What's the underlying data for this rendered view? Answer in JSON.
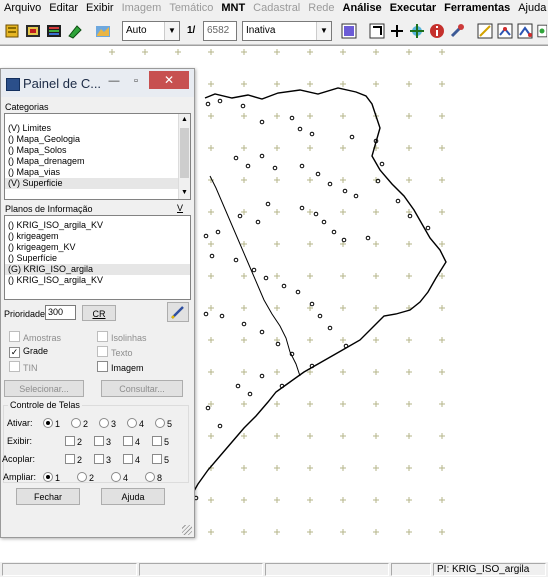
{
  "menu": [
    {
      "label": "Arquivo",
      "disabled": false,
      "bold": false
    },
    {
      "label": "Editar",
      "disabled": false,
      "bold": false
    },
    {
      "label": "Exibir",
      "disabled": false,
      "bold": false
    },
    {
      "label": "Imagem",
      "disabled": true,
      "bold": false
    },
    {
      "label": "Temático",
      "disabled": true,
      "bold": false
    },
    {
      "label": "MNT",
      "disabled": false,
      "bold": true
    },
    {
      "label": "Cadastral",
      "disabled": true,
      "bold": false
    },
    {
      "label": "Rede",
      "disabled": true,
      "bold": false
    },
    {
      "label": "Análise",
      "disabled": false,
      "bold": true
    },
    {
      "label": "Executar",
      "disabled": false,
      "bold": true
    },
    {
      "label": "Ferramentas",
      "disabled": false,
      "bold": true
    },
    {
      "label": "Ajuda",
      "disabled": false,
      "bold": false
    }
  ],
  "toolbar": {
    "zoom_mode": "Auto",
    "scale_prefix": "1/",
    "scale_value": "6582",
    "mode_value": "Inativa"
  },
  "panel": {
    "title": "Painel de C...",
    "categories_label": "Categorias",
    "categories": [
      "(V) Limites",
      "() Mapa_Geologia",
      "() Mapa_Solos",
      "() Mapa_drenagem",
      "() Mapa_vias",
      "(V) Superficie"
    ],
    "categories_selected_index": 5,
    "planos_label": "Planos de Informação",
    "planos_flag": "V",
    "planos": [
      "() KRIG_ISO_argila_KV",
      "() krigeagem",
      "() krigeagem_KV",
      "() Superfície",
      "(G) KRIG_ISO_argila",
      "() KRIG_ISO_argila_KV"
    ],
    "planos_selected_index": 4,
    "priority_label": "Prioridade:",
    "priority_value": "300",
    "cr_label": "CR",
    "checks": {
      "amostras": {
        "label": "Amostras",
        "checked": false,
        "disabled": true
      },
      "isolinhas": {
        "label": "Isolinhas",
        "checked": false,
        "disabled": true
      },
      "grade": {
        "label": "Grade",
        "checked": true,
        "disabled": false
      },
      "texto": {
        "label": "Texto",
        "checked": false,
        "disabled": true
      },
      "tin": {
        "label": "TIN",
        "checked": false,
        "disabled": true
      },
      "imagem": {
        "label": "Imagem",
        "checked": false,
        "disabled": false
      }
    },
    "selecionar_label": "Selecionar...",
    "consultar_label": "Consultar...",
    "controle_label": "Controle de Telas",
    "rows": {
      "ativar": {
        "label": "Ativar:",
        "kind": "radio",
        "options": [
          "1",
          "2",
          "3",
          "4",
          "5"
        ],
        "selected": 0
      },
      "exibir": {
        "label": "Exibir:",
        "kind": "check",
        "options": [
          "2",
          "3",
          "4",
          "5"
        ]
      },
      "acoplar": {
        "label": "Acoplar:",
        "kind": "check",
        "options": [
          "2",
          "3",
          "4",
          "5"
        ]
      },
      "ampliar": {
        "label": "Ampliar:",
        "kind": "radio",
        "options": [
          "1",
          "2",
          "4",
          "8"
        ],
        "selected": 0
      }
    },
    "fechar_label": "Fechar",
    "ajuda_label": "Ajuda"
  },
  "status": {
    "pi_label": "PI: KRIG_ISO_argila"
  }
}
